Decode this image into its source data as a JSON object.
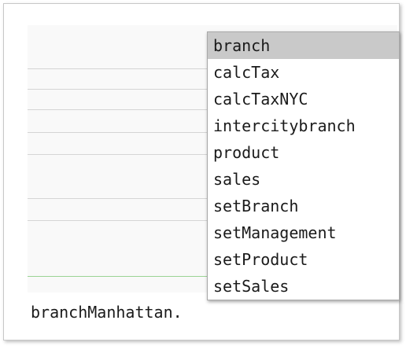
{
  "editor": {
    "code_line": "branchManhattan."
  },
  "completion_popup": {
    "selected_index": 0,
    "items": [
      "branch",
      "calcTax",
      "calcTaxNYC",
      "intercitybranch",
      "product",
      "sales",
      "setBranch",
      "setManagement",
      "setProduct",
      "setSales"
    ]
  },
  "colors": {
    "selection": "#c9c9c9",
    "divider": "#d5d5d5",
    "active_line": "#9bd494",
    "editor_background": "#f9f9f9"
  }
}
